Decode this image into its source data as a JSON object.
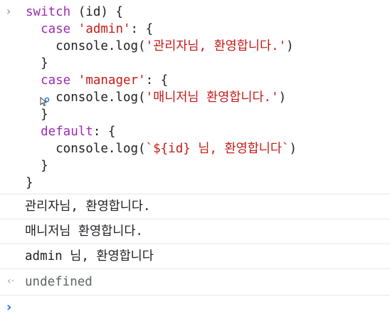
{
  "input": {
    "lines": [
      [
        {
          "t": "switch",
          "c": "kw"
        },
        {
          "t": " (id) {",
          "c": "plain"
        }
      ],
      [
        {
          "t": "  ",
          "c": "plain"
        },
        {
          "t": "case",
          "c": "kw"
        },
        {
          "t": " ",
          "c": "plain"
        },
        {
          "t": "'admin'",
          "c": "str"
        },
        {
          "t": ": {",
          "c": "plain"
        }
      ],
      [
        {
          "t": "    console.log(",
          "c": "plain"
        },
        {
          "t": "'관리자님, 환영합니다.'",
          "c": "str"
        },
        {
          "t": ")",
          "c": "plain"
        }
      ],
      [
        {
          "t": "  }",
          "c": "plain"
        }
      ],
      [
        {
          "t": "  ",
          "c": "plain"
        },
        {
          "t": "case",
          "c": "kw"
        },
        {
          "t": " ",
          "c": "plain"
        },
        {
          "t": "'manager'",
          "c": "str"
        },
        {
          "t": ": {",
          "c": "plain"
        }
      ],
      [
        {
          "t": "    console.log(",
          "c": "plain"
        },
        {
          "t": "'매니저님 환영합니다.'",
          "c": "str"
        },
        {
          "t": ")",
          "c": "plain"
        }
      ],
      [
        {
          "t": "  }",
          "c": "plain"
        }
      ],
      [
        {
          "t": "  ",
          "c": "plain"
        },
        {
          "t": "default",
          "c": "kw"
        },
        {
          "t": ": {",
          "c": "plain"
        }
      ],
      [
        {
          "t": "    console.log(",
          "c": "plain"
        },
        {
          "t": "`${id} 님, 환영합니다`",
          "c": "str"
        },
        {
          "t": ")",
          "c": "plain"
        }
      ],
      [
        {
          "t": "  }",
          "c": "plain"
        }
      ],
      [
        {
          "t": "}",
          "c": "plain"
        }
      ]
    ]
  },
  "outputs": [
    "관리자님, 환영합니다.",
    "매니저님 환영합니다.",
    "admin 님, 환영합니다"
  ],
  "result": "undefined",
  "icons": {
    "input_chevron": "chevron-right-icon",
    "result_arrow": "return-arrow-icon",
    "prompt_chevron": "prompt-chevron-icon"
  },
  "colors": {
    "keyword": "#9d2bb3",
    "string": "#c41a16",
    "prompt": "#1a73e8"
  }
}
